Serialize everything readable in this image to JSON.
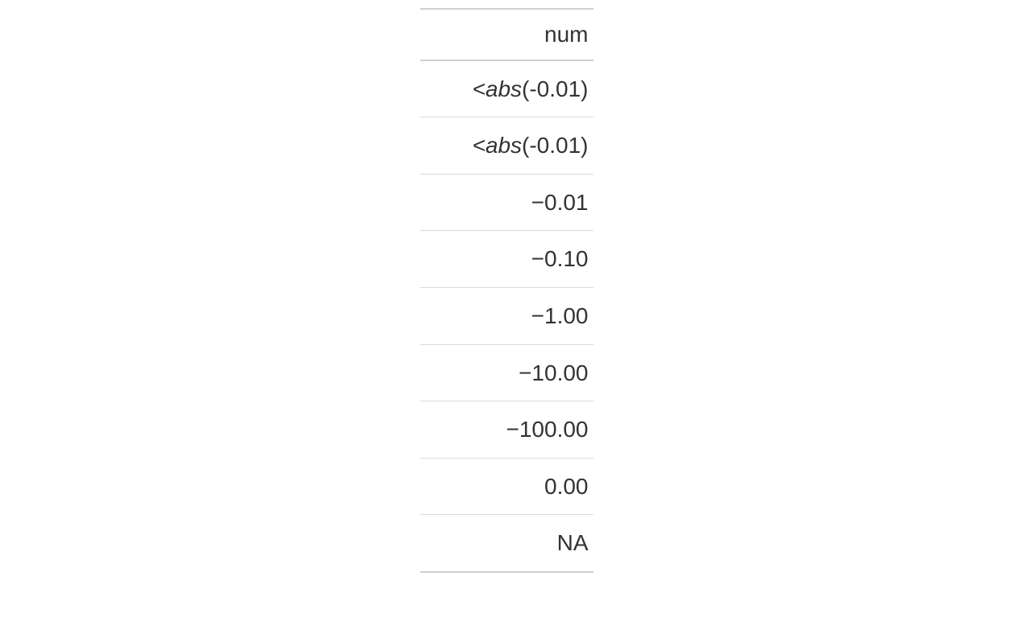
{
  "table": {
    "header": "num",
    "rows": [
      {
        "kind": "abs",
        "prefix": "<abs",
        "paren": "(-0.01)"
      },
      {
        "kind": "abs",
        "prefix": "<abs",
        "paren": "(-0.01)"
      },
      {
        "kind": "num",
        "value": "−0.01"
      },
      {
        "kind": "num",
        "value": "−0.10"
      },
      {
        "kind": "num",
        "value": "−1.00"
      },
      {
        "kind": "num",
        "value": "−10.00"
      },
      {
        "kind": "num",
        "value": "−100.00"
      },
      {
        "kind": "num",
        "value": "0.00"
      },
      {
        "kind": "na",
        "value": "NA"
      }
    ]
  }
}
